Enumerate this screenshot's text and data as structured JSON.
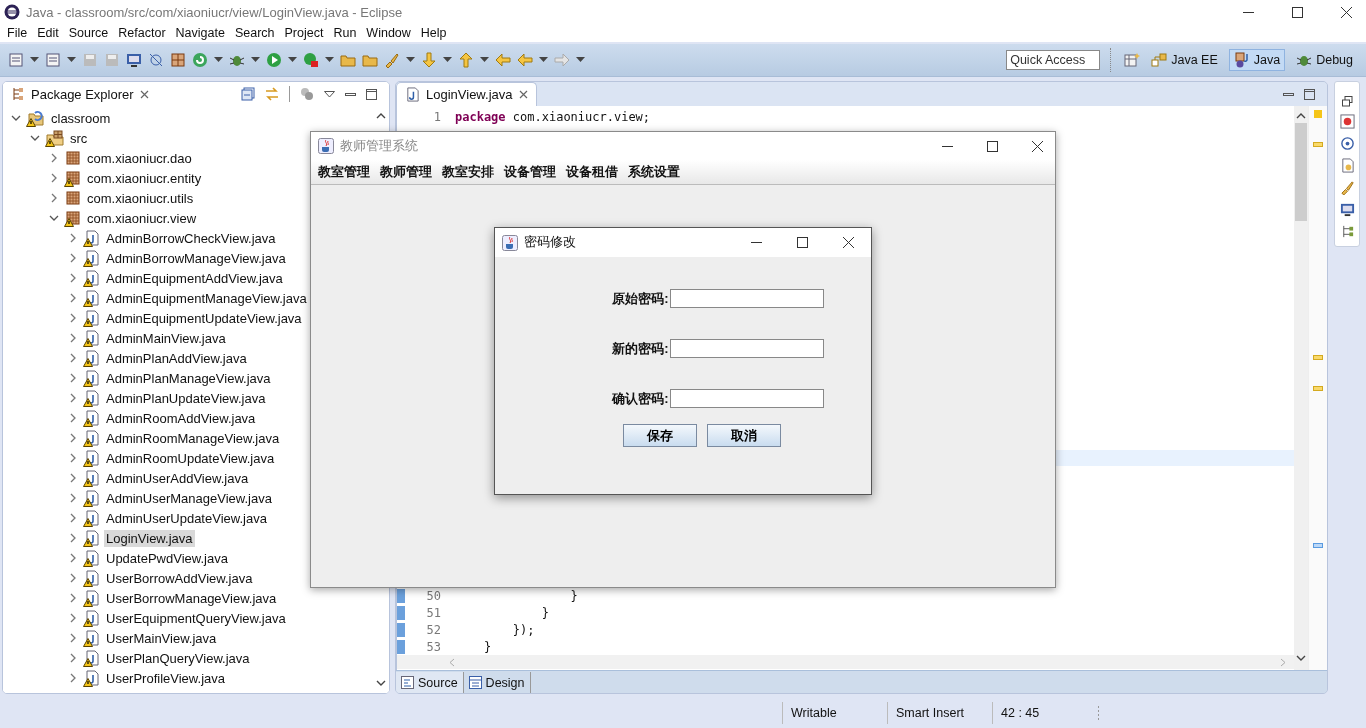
{
  "window": {
    "title": "Java - classroom/src/com/xiaoniucr/view/LoginView.java - Eclipse"
  },
  "menu": [
    "File",
    "Edit",
    "Source",
    "Refactor",
    "Navigate",
    "Search",
    "Project",
    "Run",
    "Window",
    "Help"
  ],
  "quick_access": {
    "placeholder": "Quick Access"
  },
  "perspectives": [
    {
      "label": "Java EE",
      "kind": "javaee",
      "selected": false
    },
    {
      "label": "Java",
      "kind": "java",
      "selected": true
    },
    {
      "label": "Debug",
      "kind": "debug",
      "selected": false
    }
  ],
  "package_explorer": {
    "title": "Package Explorer",
    "tree": [
      {
        "label": "classroom",
        "kind": "project",
        "expanded": true,
        "selected": false,
        "warning": true,
        "children": [
          {
            "label": "src",
            "kind": "source",
            "expanded": true,
            "selected": false,
            "warning": true,
            "children": [
              {
                "label": "com.xiaoniucr.dao",
                "kind": "package",
                "expanded": false,
                "selected": false,
                "warning": false
              },
              {
                "label": "com.xiaoniucr.entity",
                "kind": "package",
                "expanded": false,
                "selected": false,
                "warning": true
              },
              {
                "label": "com.xiaoniucr.utils",
                "kind": "package",
                "expanded": false,
                "selected": false,
                "warning": false
              },
              {
                "label": "com.xiaoniucr.view",
                "kind": "package",
                "expanded": true,
                "selected": false,
                "warning": true,
                "children": [
                  {
                    "label": "AdminBorrowCheckView.java",
                    "kind": "file",
                    "expanded": false,
                    "selected": false,
                    "warning": true
                  },
                  {
                    "label": "AdminBorrowManageView.java",
                    "kind": "file",
                    "expanded": false,
                    "selected": false,
                    "warning": true
                  },
                  {
                    "label": "AdminEquipmentAddView.java",
                    "kind": "file",
                    "expanded": false,
                    "selected": false,
                    "warning": true
                  },
                  {
                    "label": "AdminEquipmentManageView.java",
                    "kind": "file",
                    "expanded": false,
                    "selected": false,
                    "warning": true
                  },
                  {
                    "label": "AdminEquipmentUpdateView.java",
                    "kind": "file",
                    "expanded": false,
                    "selected": false,
                    "warning": true
                  },
                  {
                    "label": "AdminMainView.java",
                    "kind": "file",
                    "expanded": false,
                    "selected": false,
                    "warning": true
                  },
                  {
                    "label": "AdminPlanAddView.java",
                    "kind": "file",
                    "expanded": false,
                    "selected": false,
                    "warning": true
                  },
                  {
                    "label": "AdminPlanManageView.java",
                    "kind": "file",
                    "expanded": false,
                    "selected": false,
                    "warning": true
                  },
                  {
                    "label": "AdminPlanUpdateView.java",
                    "kind": "file",
                    "expanded": false,
                    "selected": false,
                    "warning": true
                  },
                  {
                    "label": "AdminRoomAddView.java",
                    "kind": "file",
                    "expanded": false,
                    "selected": false,
                    "warning": true
                  },
                  {
                    "label": "AdminRoomManageView.java",
                    "kind": "file",
                    "expanded": false,
                    "selected": false,
                    "warning": true
                  },
                  {
                    "label": "AdminRoomUpdateView.java",
                    "kind": "file",
                    "expanded": false,
                    "selected": false,
                    "warning": true
                  },
                  {
                    "label": "AdminUserAddView.java",
                    "kind": "file",
                    "expanded": false,
                    "selected": false,
                    "warning": true
                  },
                  {
                    "label": "AdminUserManageView.java",
                    "kind": "file",
                    "expanded": false,
                    "selected": false,
                    "warning": true
                  },
                  {
                    "label": "AdminUserUpdateView.java",
                    "kind": "file",
                    "expanded": false,
                    "selected": false,
                    "warning": true
                  },
                  {
                    "label": "LoginView.java",
                    "kind": "file",
                    "expanded": false,
                    "selected": true,
                    "warning": true
                  },
                  {
                    "label": "UpdatePwdView.java",
                    "kind": "file",
                    "expanded": false,
                    "selected": false,
                    "warning": true
                  },
                  {
                    "label": "UserBorrowAddView.java",
                    "kind": "file",
                    "expanded": false,
                    "selected": false,
                    "warning": true
                  },
                  {
                    "label": "UserBorrowManageView.java",
                    "kind": "file",
                    "expanded": false,
                    "selected": false,
                    "warning": true
                  },
                  {
                    "label": "UserEquipmentQueryView.java",
                    "kind": "file",
                    "expanded": false,
                    "selected": false,
                    "warning": true
                  },
                  {
                    "label": "UserMainView.java",
                    "kind": "file",
                    "expanded": false,
                    "selected": false,
                    "warning": true
                  },
                  {
                    "label": "UserPlanQueryView.java",
                    "kind": "file",
                    "expanded": false,
                    "selected": false,
                    "warning": true
                  },
                  {
                    "label": "UserProfileView.java",
                    "kind": "file",
                    "expanded": false,
                    "selected": false,
                    "warning": true
                  }
                ]
              }
            ]
          }
        ]
      }
    ]
  },
  "editor": {
    "tab": "LoginView.java",
    "top_lines": [
      {
        "number": "1",
        "keyword": "package",
        "code": " com.xiaoniucr.view;"
      }
    ],
    "bottom_lines": [
      {
        "number": "50",
        "code": "                }"
      },
      {
        "number": "51",
        "code": "            }"
      },
      {
        "number": "52",
        "code": "        });"
      },
      {
        "number": "53",
        "code": "    }"
      }
    ],
    "bottom_tabs": [
      {
        "label": "Source",
        "selected": true
      },
      {
        "label": "Design",
        "selected": false
      }
    ]
  },
  "app_window": {
    "title": "教师管理系统",
    "menu": [
      "教室管理",
      "教师管理",
      "教室安排",
      "设备管理",
      "设备租借",
      "系统设置"
    ]
  },
  "dialog": {
    "title": "密码修改",
    "fields": [
      {
        "label": "原始密码:"
      },
      {
        "label": "新的密码:"
      },
      {
        "label": "确认密码:"
      }
    ],
    "buttons": [
      "保存",
      "取消"
    ]
  },
  "status_bar": [
    "Writable",
    "Smart Insert",
    "42 : 45"
  ]
}
